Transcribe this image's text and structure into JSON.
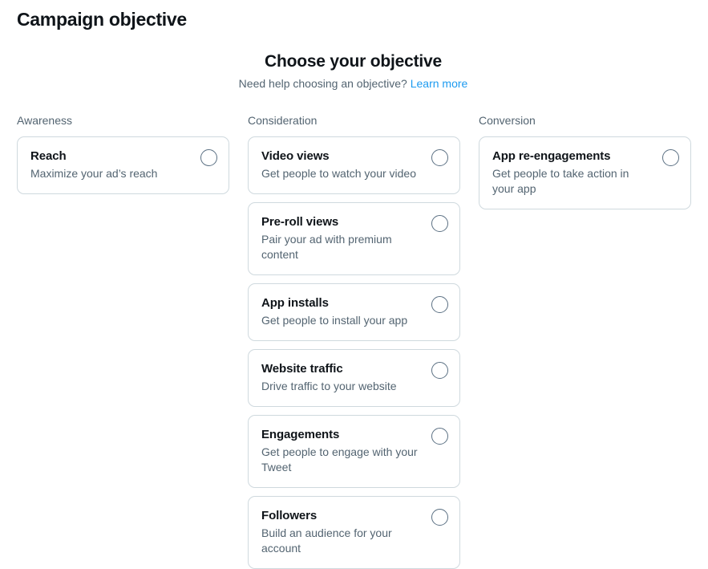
{
  "page": {
    "title": "Campaign objective"
  },
  "header": {
    "heading": "Choose your objective",
    "helper_text": "Need help choosing an objective?",
    "learn_more_label": "Learn more",
    "link_color": "#1d9bf0"
  },
  "colors": {
    "text_primary": "#0f1419",
    "text_secondary": "#536471",
    "card_border": "#cfd9de",
    "radio_border": "#5b7083",
    "background": "#ffffff"
  },
  "columns": [
    {
      "label": "Awareness",
      "cards": [
        {
          "title": "Reach",
          "description": "Maximize your ad’s reach",
          "selected": false,
          "radio_name": "radio-reach"
        }
      ]
    },
    {
      "label": "Consideration",
      "cards": [
        {
          "title": "Video views",
          "description": "Get people to watch your video",
          "selected": false,
          "radio_name": "radio-video-views"
        },
        {
          "title": "Pre-roll views",
          "description": "Pair your ad with premium content",
          "selected": false,
          "radio_name": "radio-pre-roll-views"
        },
        {
          "title": "App installs",
          "description": "Get people to install your app",
          "selected": false,
          "radio_name": "radio-app-installs"
        },
        {
          "title": "Website traffic",
          "description": "Drive traffic to your website",
          "selected": false,
          "radio_name": "radio-website-traffic"
        },
        {
          "title": "Engagements",
          "description": "Get people to engage with your Tweet",
          "selected": false,
          "radio_name": "radio-engagements"
        },
        {
          "title": "Followers",
          "description": "Build an audience for your account",
          "selected": false,
          "radio_name": "radio-followers"
        }
      ]
    },
    {
      "label": "Conversion",
      "cards": [
        {
          "title": "App re-engagements",
          "description": "Get people to take action in your app",
          "selected": false,
          "radio_name": "radio-app-re-engagements"
        }
      ]
    }
  ]
}
